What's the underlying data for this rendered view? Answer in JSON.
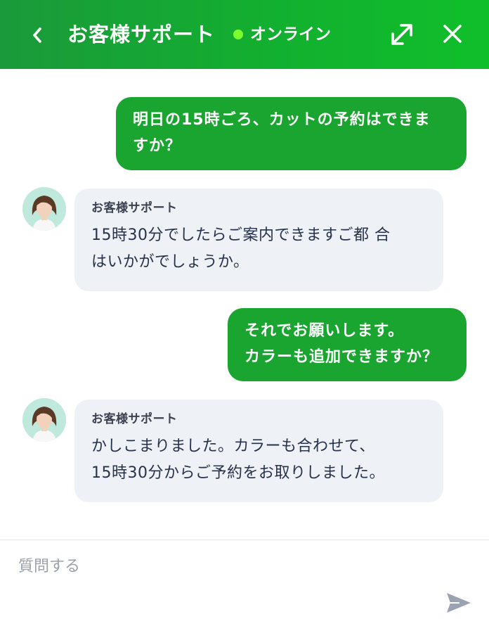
{
  "header": {
    "title": "お客様サポート",
    "status": "オンライン",
    "back_icon": "chevron-left-icon",
    "expand_icon": "expand-icon",
    "close_icon": "close-icon",
    "brand_color": "#12b12f",
    "status_color": "#7dff2e"
  },
  "messages": [
    {
      "from": "user",
      "lines": [
        "明日の15時ごろ、カットの予約はできま",
        "すか？"
      ]
    },
    {
      "from": "support",
      "sender": "お客様サポート",
      "lines": [
        "15時30分でしたらご案内できますご都 合",
        "はいかがでしょうか。"
      ]
    },
    {
      "from": "user",
      "lines": [
        "それでお願いします。",
        "カラーも追加できますか？"
      ]
    },
    {
      "from": "support",
      "sender": "お客様サポート",
      "lines": [
        "かしこまりました。カラーも合わせて、",
        "15時30分からご予約をお取りしました。"
      ]
    }
  ],
  "composer": {
    "placeholder": "質問する",
    "value": "",
    "send_icon": "send-icon"
  }
}
